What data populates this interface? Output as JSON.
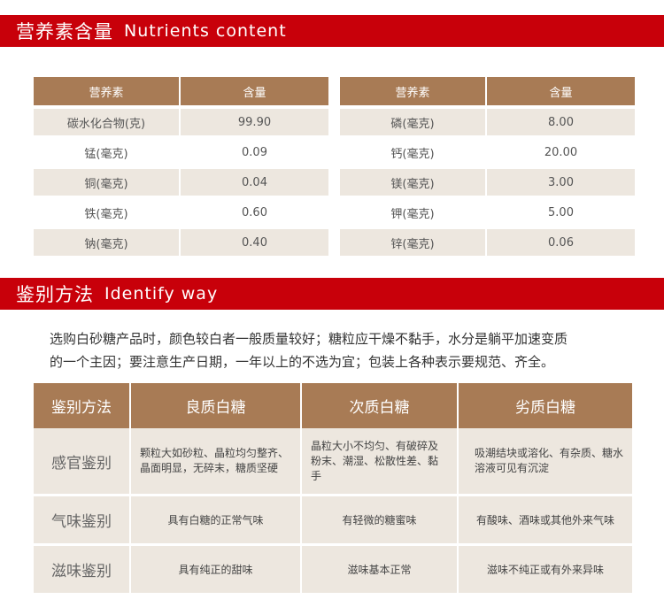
{
  "nutrients_section": {
    "title_cn": "营养素含量",
    "title_en": "Nutrients content"
  },
  "nutrient_tables": [
    {
      "header": [
        "营养素",
        "含量"
      ],
      "rows": [
        [
          "碳水化合物(克)",
          "99.90"
        ],
        [
          "锰(毫克)",
          "0.09"
        ],
        [
          "铜(毫克)",
          "0.04"
        ],
        [
          "铁(毫克)",
          "0.60"
        ],
        [
          "钠(毫克)",
          "0.40"
        ]
      ]
    },
    {
      "header": [
        "营养素",
        "含量"
      ],
      "rows": [
        [
          "磷(毫克)",
          "8.00"
        ],
        [
          "钙(毫克)",
          "20.00"
        ],
        [
          "镁(毫克)",
          "3.00"
        ],
        [
          "钾(毫克)",
          "5.00"
        ],
        [
          "锌(毫克)",
          "0.06"
        ]
      ]
    }
  ],
  "identify_section": {
    "title_cn": "鉴别方法",
    "title_en": "Identify way",
    "intro_line1": "选购白砂糖产品时，颜色较白者一般质量较好；糖粒应干燥不黏手，水分是躺平加速变质",
    "intro_line2": "的一个主因；要注意生产日期，一年以上的不选为宜；包装上各种表示要规范、齐全。"
  },
  "identify_table": {
    "header": [
      "鉴别方法",
      "良质白糖",
      "次质白糖",
      "劣质白糖"
    ],
    "rows": [
      [
        "感官鉴别",
        "颗粒大如砂粒、晶粒均匀整齐、晶面明显，无碎末，糖质坚硬",
        "晶粒大小不均匀、有破碎及粉末、潮湿、松散性差、黏手",
        "吸潮结块或溶化、有杂质、糖水溶液可见有沉淀"
      ],
      [
        "气味鉴别",
        "具有白糖的正常气味",
        "有轻微的糖蜜味",
        "有酸味、酒味或其他外来气味"
      ],
      [
        "滋味鉴别",
        "具有纯正的甜味",
        "滋味基本正常",
        "滋味不纯正或有外来异味"
      ]
    ]
  }
}
